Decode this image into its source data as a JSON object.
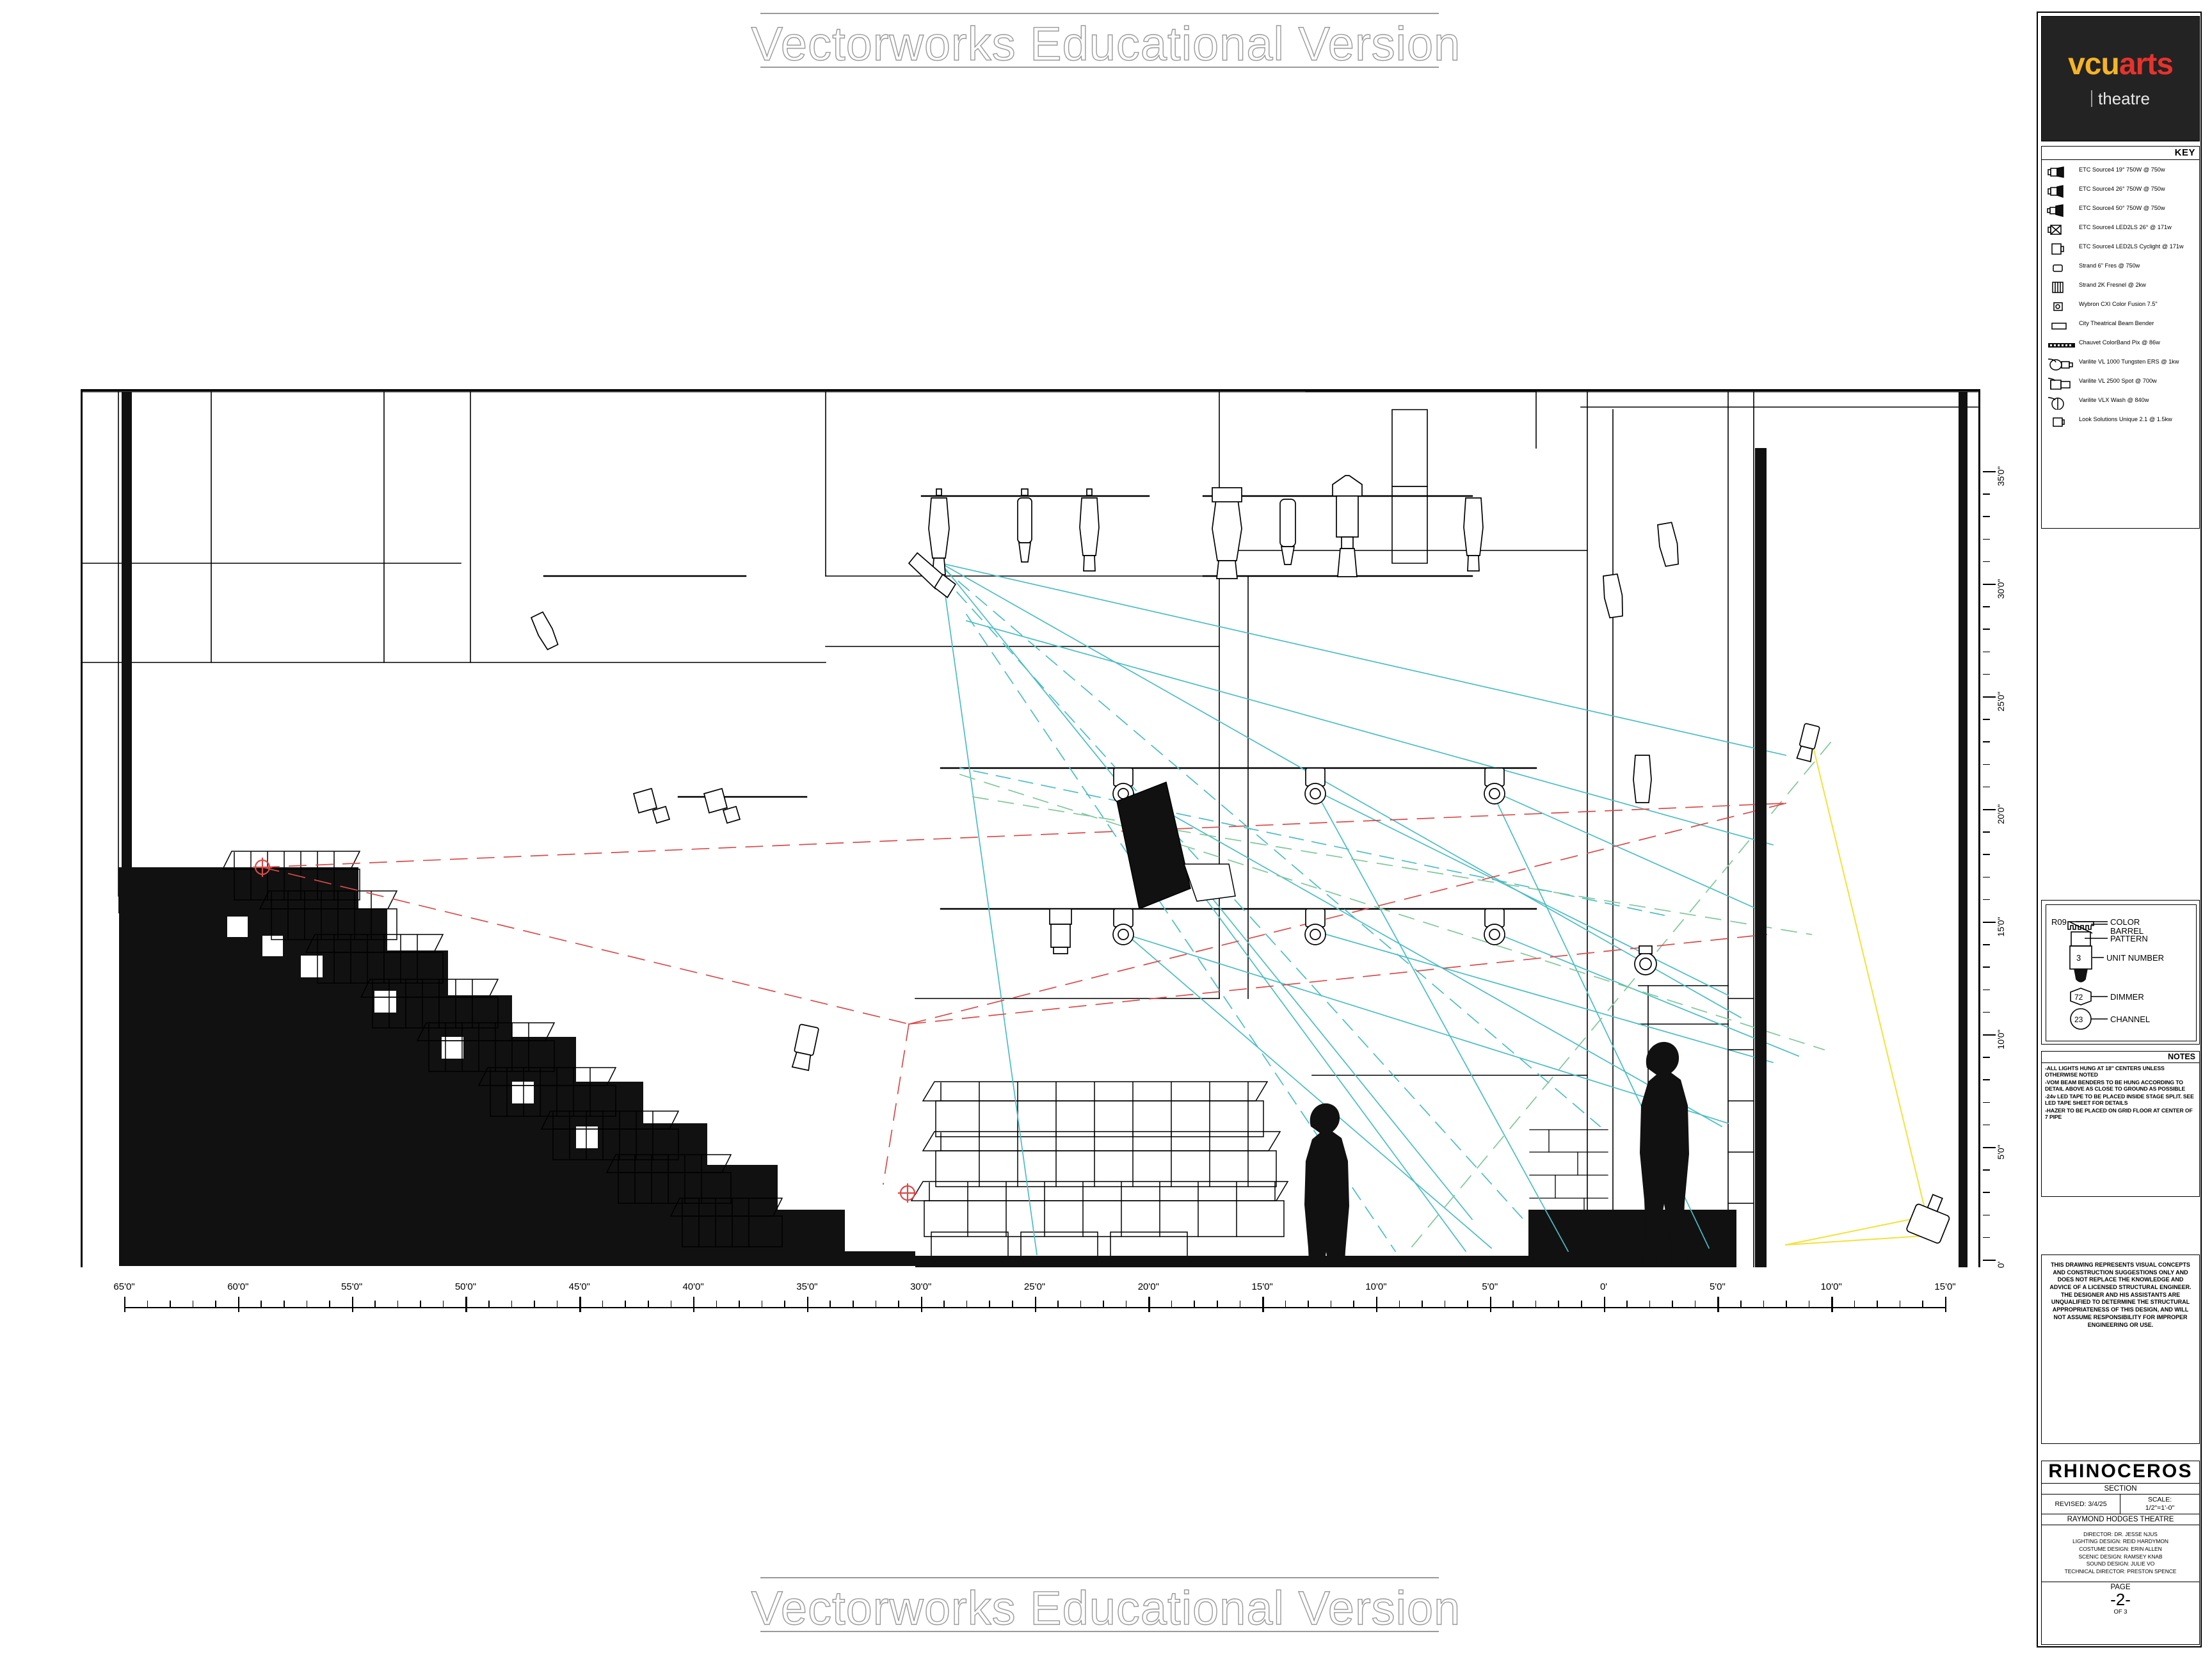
{
  "watermark": {
    "text": "Vectorworks Educational Version"
  },
  "logo": {
    "vcu": "vcu",
    "arts": "arts",
    "unit": "theatre"
  },
  "key": {
    "header": "KEY",
    "items": [
      {
        "symbol": "ellipsoidal-19",
        "label": "ETC Source4 19° 750W @ 750w"
      },
      {
        "symbol": "ellipsoidal-26",
        "label": "ETC Source4 26° 750W @ 750w"
      },
      {
        "symbol": "ellipsoidal-50",
        "label": "ETC Source4 50° 750W @ 750w"
      },
      {
        "symbol": "led-ellipsoidal",
        "label": "ETC Source4 LED2LS 26° @ 171w"
      },
      {
        "symbol": "cyclight",
        "label": "ETC Source4 LED2LS Cyclight @ 171w"
      },
      {
        "symbol": "fresnel-6",
        "label": "Strand 6\" Fres @ 750w"
      },
      {
        "symbol": "fresnel-2k",
        "label": "Strand 2K Fresnel @ 2kw"
      },
      {
        "symbol": "color-scroller",
        "label": "Wybron CXI Color Fusion 7.5\""
      },
      {
        "symbol": "beam-bender",
        "label": "City Theatrical Beam Bender"
      },
      {
        "symbol": "colorband-pix",
        "label": "Chauvet ColorBand Pix @ 86w"
      },
      {
        "symbol": "vl1000",
        "label": "Varilite VL 1000 Tungsten ERS @ 1kw"
      },
      {
        "symbol": "vl2500",
        "label": "Varilite VL 2500 Spot @ 700w"
      },
      {
        "symbol": "vlx-wash",
        "label": "Varilite VLX Wash @ 840w"
      },
      {
        "symbol": "hazer",
        "label": "Look Solutions Unique 2.1 @ 1.5kw"
      }
    ]
  },
  "symbol_legend": {
    "color": {
      "value": "R09",
      "label": "COLOR"
    },
    "barrel": {
      "label": "BARREL"
    },
    "pattern": {
      "label": "PATTERN"
    },
    "unit_number": {
      "value": "3",
      "label": "UNIT NUMBER"
    },
    "dimmer": {
      "value": "72",
      "label": "DIMMER"
    },
    "channel": {
      "value": "23",
      "label": "CHANNEL"
    }
  },
  "notes": {
    "header": "NOTES",
    "lines": [
      "-ALL LIGHTS HUNG AT 18\" CENTERS UNLESS OTHERWISE NOTED",
      "-VOM BEAM BENDERS TO BE HUNG ACCORDING TO DETAIL ABOVE AS CLOSE TO GROUND AS POSSIBLE",
      "-24v LED TAPE TO BE PLACED INSIDE STAGE SPLIT. SEE LED TAPE SHEET FOR DETAILS",
      "-HAZER TO BE PLACED ON GRID FLOOR AT CENTER OF 7 PIPE"
    ]
  },
  "disclaimer": {
    "text": "THIS DRAWING REPRESENTS VISUAL CONCEPTS AND CONSTRUCTION SUGGESTIONS ONLY AND DOES NOT REPLACE THE KNOWLEDGE AND ADVICE OF A LICENSED STRUCTURAL ENGINEER.  THE DESIGNER AND HIS ASSISTANTS ARE UNQUALIFIED TO DETERMINE THE STRUCTURAL APPROPRIATENESS OF THIS DESIGN, AND WILL NOT ASSUME RESPONSIBILITY FOR IMPROPER ENGINEERING OR USE."
  },
  "title_block": {
    "show": "RHINOCEROS",
    "sheet_name": "SECTION",
    "revised": "REVISED: 3/4/25",
    "scale_label": "SCALE:",
    "scale_value": "1/2\"=1'-0\"",
    "venue": "RAYMOND HODGES THEATRE",
    "credits": [
      "DIRECTOR: DR. JESSE NJUS",
      "LIGHTING DESIGN: REID HARDYMON",
      "COSTUME DESIGN: ERIN ALLEN",
      "SCENIC DESIGN: RAMSEY KNAB",
      "SOUND DESIGN: JULIE VO",
      "TECHNICAL DIRECTOR: PRESTON SPENCE"
    ],
    "page_label": "PAGE",
    "page_number": "-2-",
    "page_of": "OF 3"
  },
  "scales": {
    "horizontal": {
      "labels": [
        "65'0\"",
        "60'0\"",
        "55'0\"",
        "50'0\"",
        "45'0\"",
        "40'0\"",
        "35'0\"",
        "30'0\"",
        "25'0\"",
        "20'0\"",
        "15'0\"",
        "10'0\"",
        "5'0\"",
        "0'",
        "5'0\"",
        "10'0\"",
        "15'0\""
      ],
      "unit_text": "'"
    },
    "vertical": {
      "labels": [
        "35'0\"",
        "30'0\"",
        "25'0\"",
        "20'0\"",
        "15'0\"",
        "10'0\"",
        "5'0\"",
        "0'"
      ]
    }
  },
  "colors": {
    "beam_cyan": "#4bbdc4",
    "beam_red": "#d94a4a",
    "beam_green": "#7fc79b",
    "beam_yellow": "#f2e23a",
    "logo_gold": "#f5b427",
    "logo_red": "#e8322c",
    "logo_bg": "#232323",
    "line_black": "#000000",
    "watermark_gray": "#9a9a9a"
  }
}
